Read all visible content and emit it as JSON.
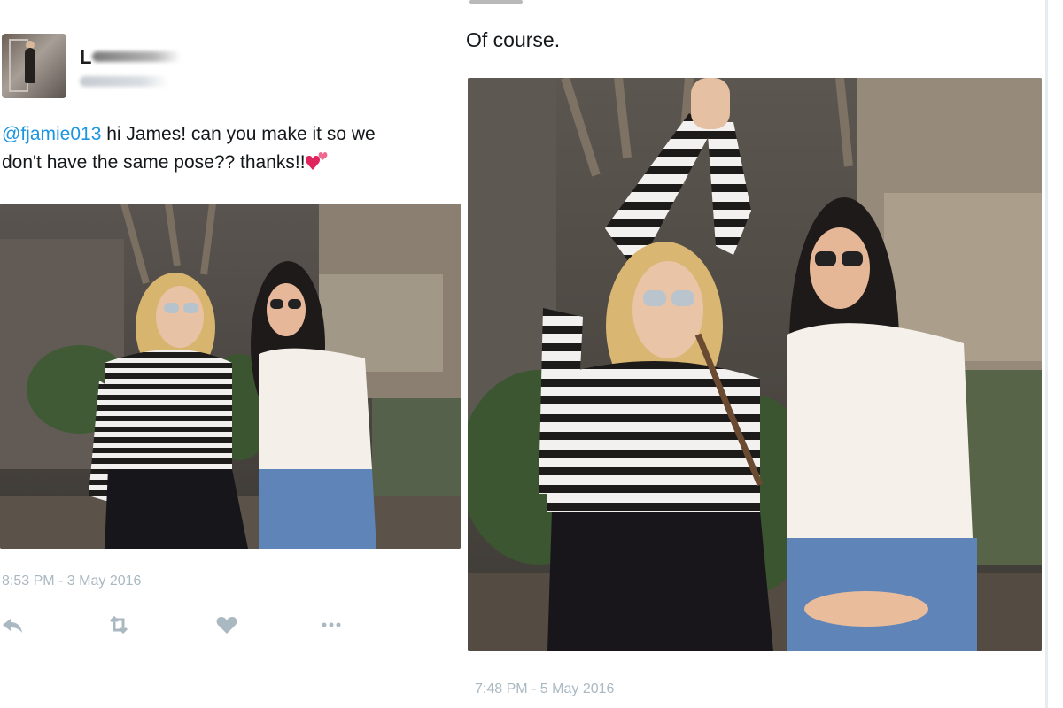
{
  "left_tweet": {
    "display_name": "L",
    "tweet_text_mention": "@fjamie013",
    "tweet_text_line1_rest": " hi James! can you make it so we",
    "tweet_text_line2": "don't have the same pose?? thanks!!",
    "timestamp": "8:53 PM - 3 May 2016",
    "actions": [
      "reply-icon",
      "retweet-icon",
      "like-icon",
      "more-icon"
    ]
  },
  "right_tweet": {
    "text": "Of course.",
    "timestamp": "7:48 PM - 5 May 2016"
  },
  "colors": {
    "mention": "#1b95e0",
    "timestamp": "#aab8c2",
    "heart": "#e0245e"
  }
}
